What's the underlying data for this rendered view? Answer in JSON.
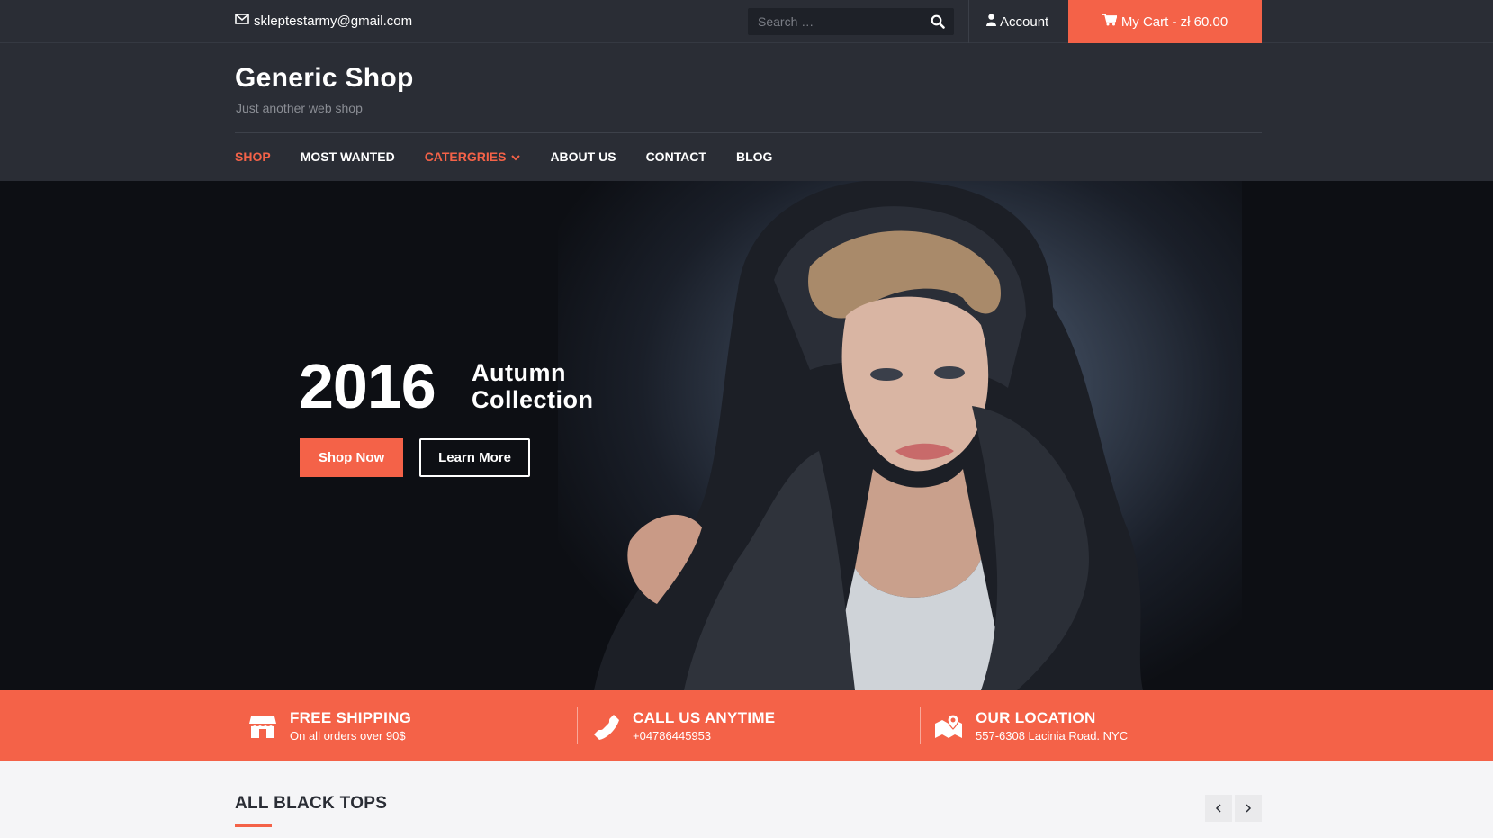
{
  "topbar": {
    "email": "skleptestarmy@gmail.com",
    "search_placeholder": "Search …",
    "account_label": "Account",
    "cart_label": "My Cart - zł 60.00"
  },
  "header": {
    "site_title": "Generic Shop",
    "tagline": "Just another web shop"
  },
  "nav": {
    "items": [
      {
        "label": "SHOP"
      },
      {
        "label": "MOST WANTED"
      },
      {
        "label": "CATERGRIES"
      },
      {
        "label": "ABOUT US"
      },
      {
        "label": "CONTACT"
      },
      {
        "label": "BLOG"
      }
    ]
  },
  "hero": {
    "year": "2016",
    "line1": "Autumn",
    "line2": "Collection",
    "shop_now": "Shop Now",
    "learn_more": "Learn More"
  },
  "features": [
    {
      "title": "FREE SHIPPING",
      "text": "On all orders over 90$",
      "icon": "store-icon"
    },
    {
      "title": "CALL US ANYTIME",
      "text": "+04786445953",
      "icon": "phone-icon"
    },
    {
      "title": "OUR LOCATION",
      "text": "557-6308 Lacinia Road. NYC",
      "icon": "map-icon"
    }
  ],
  "section": {
    "title": "ALL BLACK TOPS"
  },
  "colors": {
    "accent": "#f46248",
    "dark": "#2a2d35"
  }
}
